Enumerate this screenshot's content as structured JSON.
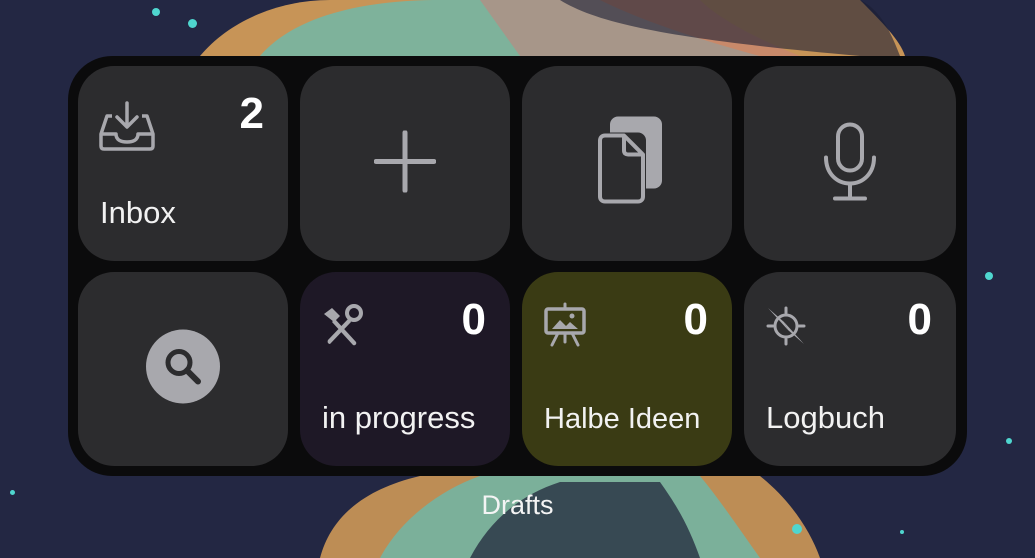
{
  "widget": {
    "title": "Drafts",
    "tiles": [
      {
        "label": "Inbox",
        "count": "2",
        "icon": "inbox-icon"
      },
      {
        "label": "",
        "icon": "plus-icon"
      },
      {
        "label": "",
        "icon": "copy-icon"
      },
      {
        "label": "",
        "icon": "microphone-icon"
      },
      {
        "label": "",
        "icon": "search-icon"
      },
      {
        "label": "in progress",
        "count": "0",
        "icon": "hammer-wrench-icon",
        "color": "#1e1826"
      },
      {
        "label": "Halbe Ideen",
        "count": "0",
        "icon": "presentation-easel-icon",
        "color": "#3a3b14"
      },
      {
        "label": "Logbuch",
        "count": "0",
        "icon": "compass-icon",
        "color": "#2c2c2e"
      }
    ]
  },
  "colors": {
    "background": "#232743",
    "tile": "#2c2c2e",
    "accent_teal": "#4fd6cf"
  }
}
